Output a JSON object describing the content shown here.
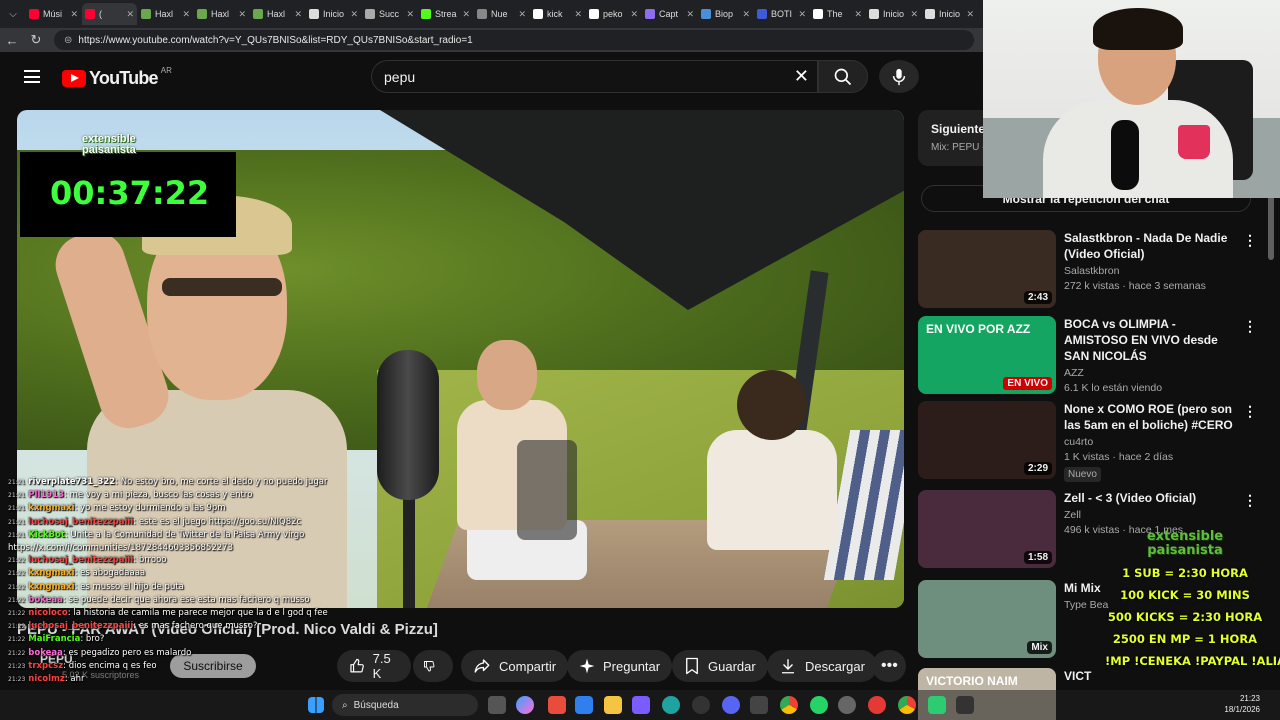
{
  "browser": {
    "tabs": [
      {
        "label": "Músi",
        "color": "#ff0033",
        "active": false
      },
      {
        "label": "(",
        "color": "#ff0033",
        "active": true
      },
      {
        "label": "Haxl",
        "color": "#6aa84f",
        "active": false
      },
      {
        "label": "Haxl",
        "color": "#6aa84f",
        "active": false
      },
      {
        "label": "Haxl",
        "color": "#6aa84f",
        "active": false
      },
      {
        "label": "Inicio",
        "color": "#dddddd",
        "active": false
      },
      {
        "label": "Succ",
        "color": "#aaaaaa",
        "active": false
      },
      {
        "label": "Strea",
        "color": "#53fc18",
        "active": false
      },
      {
        "label": "Nue",
        "color": "#888888",
        "active": false
      },
      {
        "label": "kick",
        "color": "#ffffff",
        "active": false
      },
      {
        "label": "peko",
        "color": "#ffffff",
        "active": false
      },
      {
        "label": "Capt",
        "color": "#8e6cef",
        "active": false
      },
      {
        "label": "Biop",
        "color": "#4a90d9",
        "active": false
      },
      {
        "label": "BOTI",
        "color": "#3b5bdb",
        "active": false
      },
      {
        "label": "The",
        "color": "#ffffff",
        "active": false
      },
      {
        "label": "Inicio",
        "color": "#dddddd",
        "active": false
      },
      {
        "label": "Inicio",
        "color": "#dddddd",
        "active": false
      }
    ],
    "url": "https://www.youtube.com/watch?v=Y_QUs7BNISo&list=RDY_QUs7BNISo&start_radio=1"
  },
  "masthead": {
    "logo_text": "YouTube",
    "country_code": "AR",
    "search_value": "pepu"
  },
  "overlay": {
    "brand_line1": "extensible",
    "brand_line2": "paisanista",
    "timer": "00:37:22"
  },
  "chat": [
    {
      "time": "21:21",
      "user": "riverplate731_322",
      "msg": ": No estoy bro, me corte el dedo y no puedo jugar",
      "color": "#ffffff"
    },
    {
      "time": "21:21",
      "user": "Pll1913",
      "msg": ": me voy a mi pieza, busco las cosas y entro",
      "color": "#ff6ad5"
    },
    {
      "time": "21:21",
      "user": "kxngmaxi",
      "msg": ": yo me estoy durmiendo a las 9pm",
      "color": "#ffb020"
    },
    {
      "time": "21:21",
      "user": "luchosaj_benitezzpaiii",
      "msg": ": este es el juego https://goo.su/NIQ82c",
      "color": "#ff4040"
    },
    {
      "time": "21:21",
      "user": "KickBot",
      "msg": ": Unite a la Comunidad de Twitter de la Paisa Army virgo",
      "color": "#53fc18"
    },
    {
      "time": "",
      "user": "",
      "msg": "https://x.com/i/communities/1872844603356852273",
      "color": "#ffffff"
    },
    {
      "time": "21:22",
      "user": "luchosaj_benitezzpaiii",
      "msg": ": brrooo",
      "color": "#ff4040"
    },
    {
      "time": "21:22",
      "user": "kxngmaxi",
      "msg": ": es abogadaaaa",
      "color": "#ffb020"
    },
    {
      "time": "21:22",
      "user": "kxngmaxi",
      "msg": ": es musso el hijo de puta",
      "color": "#ffb020"
    },
    {
      "time": "21:22",
      "user": "bokeaa",
      "msg": ": se puede decir que ahora ese esta mas fachero q musso",
      "color": "#ff6ad5"
    },
    {
      "time": "21:22",
      "user": "nicoloco",
      "msg": ": la historia de camila me parece mejor que la d e l god q feeling",
      "color": "#ff4040"
    },
    {
      "time": "21:22",
      "user": "luchosaj_benitezzpaiii",
      "msg": ": es mas fachero que musso?",
      "color": "#ff4040"
    },
    {
      "time": "21:22",
      "user": "MaiFrancia",
      "msg": ": bro?",
      "color": "#53fc18"
    },
    {
      "time": "21:22",
      "user": "bokeaa",
      "msg": ": es pegadizo pero es malardo",
      "color": "#ff6ad5"
    },
    {
      "time": "21:23",
      "user": "trxpcsz",
      "msg": ": dios encima q es feo",
      "color": "#ff4040"
    },
    {
      "time": "21:23",
      "user": "nicolmz",
      "msg": ": ahr",
      "color": "#ff4040"
    }
  ],
  "video": {
    "title": "PEPU - FAR AWAY (Video Oficial) [Prod. Nico Valdi & Pizzu]",
    "channel": "PEPU",
    "subscribers": "5.02 K suscriptores",
    "subscribe_label": "Suscribirse",
    "likes": "7.5 K",
    "share_label": "Compartir",
    "ask_label": "Preguntar",
    "save_label": "Guardar",
    "download_label": "Descargar"
  },
  "sidebar": {
    "next_heading": "Siguiente",
    "next_sub": "Mix: PEPU -",
    "chat_replay_label": "Mostrar la repetición del chat",
    "recommendations": [
      {
        "title": "Salastkbron - Nada De Nadie (Video Oficial)",
        "channel": "Salastkbron",
        "meta": "272 k vistas · hace 3 semanas",
        "duration": "2:43",
        "thumb": "#3a2b22"
      },
      {
        "title": "BOCA vs OLIMPIA - AMISTOSO EN VIVO desde SAN NICOLÁS",
        "channel": "AZZ",
        "meta": "6.1 K lo están viendo",
        "live": "EN VIVO",
        "thumb_text": "EN VIVO POR AZZ",
        "thumb": "#13a561"
      },
      {
        "title": "None x COMO ROE (pero son las 5am en el boliche) #CERO",
        "channel": "cu4rto",
        "meta": "1 K vistas · hace 2 días",
        "badge": "Nuevo",
        "duration": "2:29",
        "thumb": "#2c1d1a"
      },
      {
        "title": "Zell - < 3 (Video Oficial)",
        "channel": "Zell",
        "meta": "496 k vistas · hace 1 mes",
        "duration": "1:58",
        "thumb": "#4a2a3d"
      },
      {
        "title": "Mi Mix",
        "channel": "Type Bea",
        "meta": "",
        "duration": "Mix",
        "thumb": "#6f8f7e"
      },
      {
        "title": "VICT",
        "channel": "",
        "meta": "",
        "thumb_text": "VICTORIO NAIM",
        "thumb": "#bfb5a4"
      }
    ]
  },
  "goals": {
    "brand_line1": "extensible",
    "brand_line2": "paisanista",
    "lines": [
      "1 SUB = 2:30 HORA",
      "100 KICK = 30 MINS",
      "500 KICKS = 2:30 HORA",
      "2500 EN MP = 1 HORA",
      "!MP !CENEKA !PAYPAL !ALIAS"
    ]
  },
  "taskbar": {
    "search_placeholder": "Búsqueda",
    "time": "21:23",
    "date": "18/1/2026"
  }
}
